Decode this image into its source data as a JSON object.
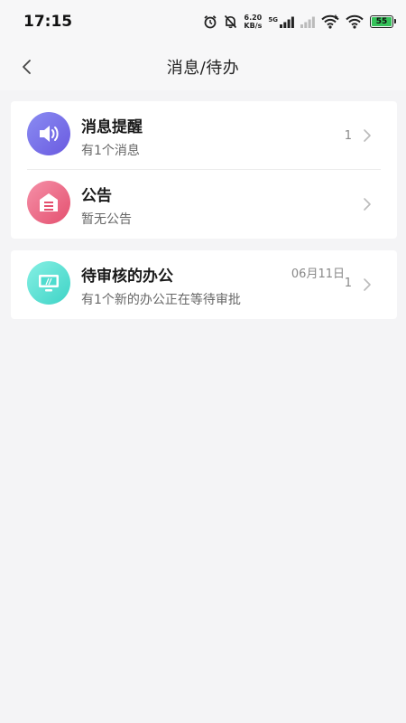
{
  "status_bar": {
    "time": "17:15",
    "net_speed_value": "6.20",
    "net_speed_unit": "KB/s",
    "network_type": "5G",
    "battery": "55",
    "battery_color": "#35c25a"
  },
  "header": {
    "title": "消息/待办"
  },
  "messages": [
    {
      "title": "消息提醒",
      "subtitle": "有1个消息",
      "count": "1",
      "icon": "speaker-icon",
      "color": "#7a74ea"
    },
    {
      "title": "公告",
      "subtitle": "暂无公告",
      "count": "",
      "icon": "announcement-icon",
      "color": "#ea6f8a"
    }
  ],
  "todo": {
    "title": "待审核的办公",
    "subtitle": "有1个新的办公正在等待审批",
    "date": "06月11日",
    "count": "1",
    "icon": "computer-icon",
    "color": "#4fdccf"
  }
}
